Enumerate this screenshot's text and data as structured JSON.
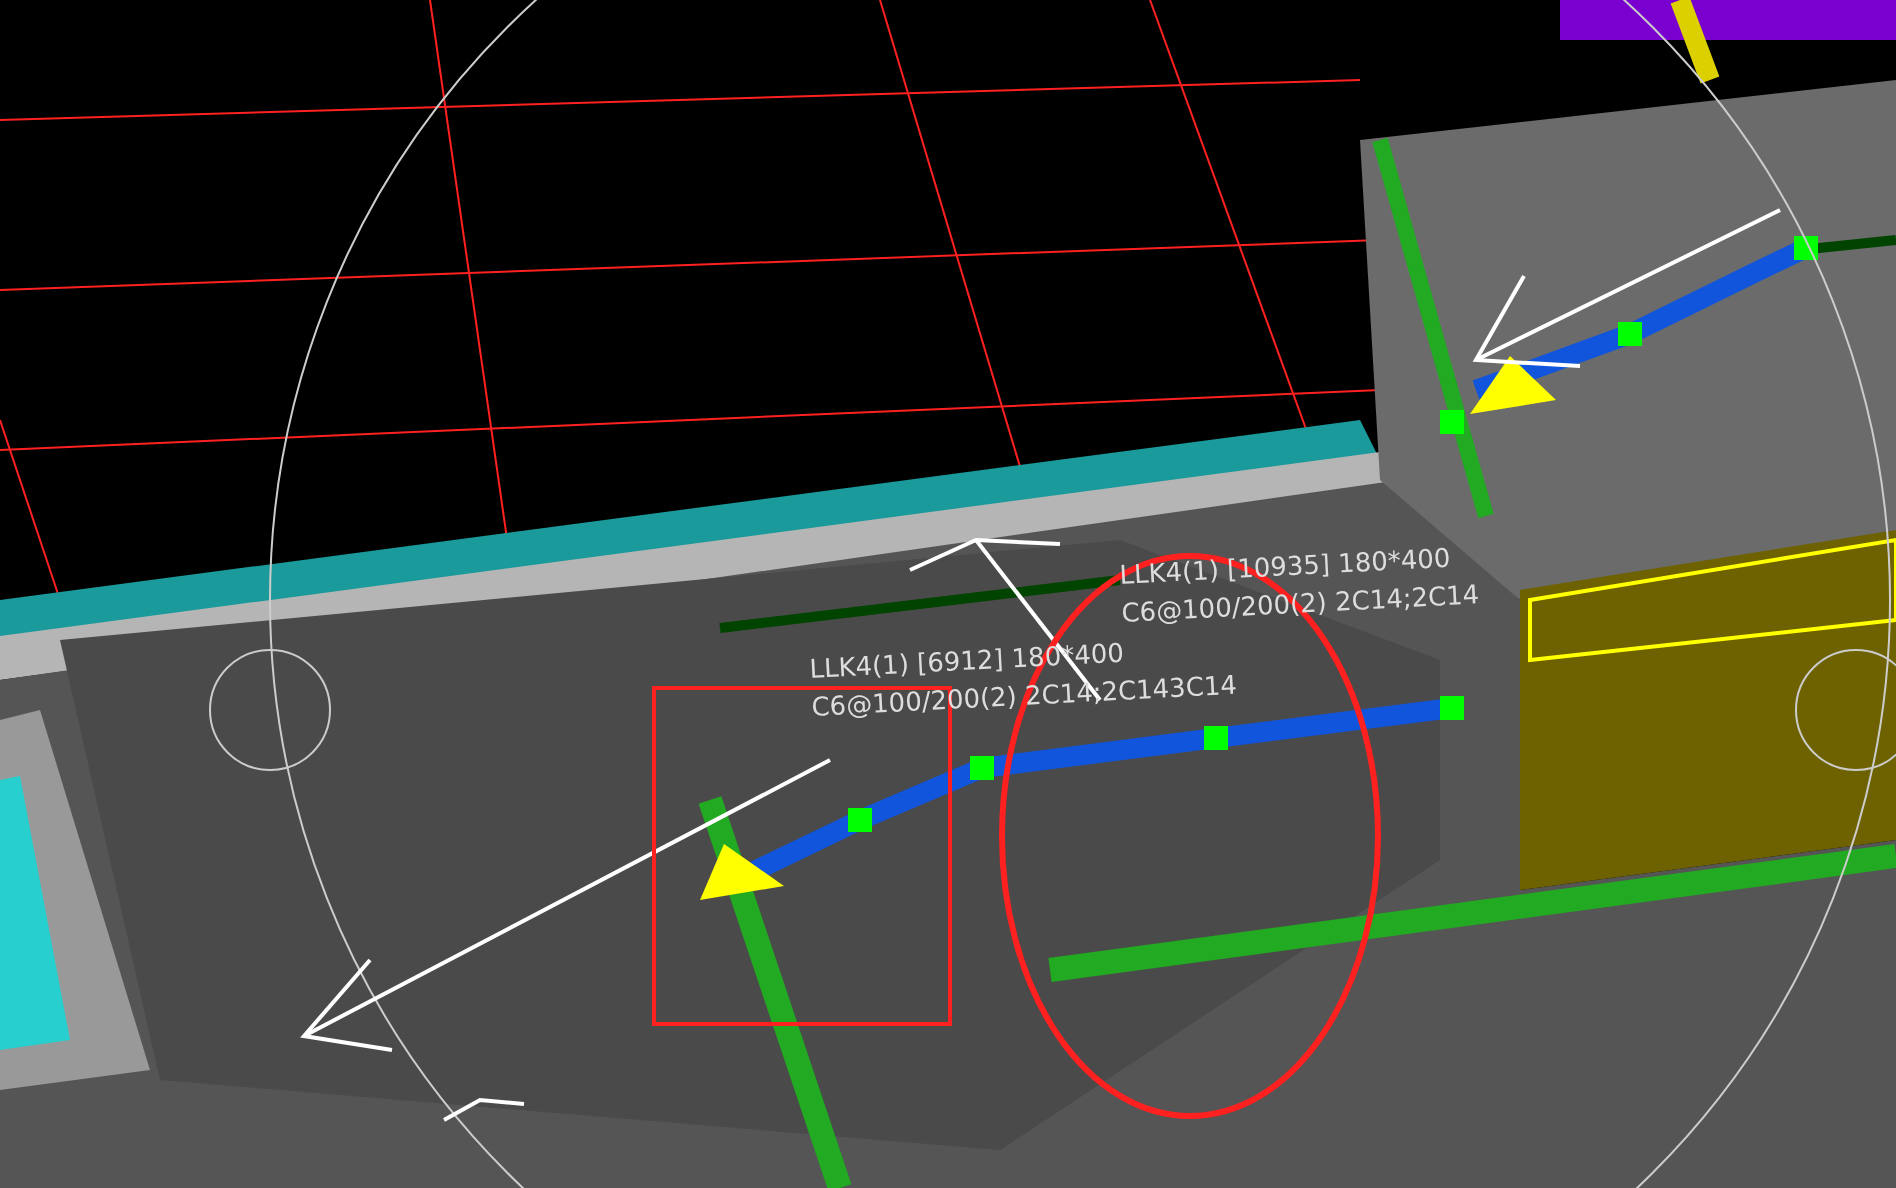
{
  "viewport": {
    "beam_labels": [
      {
        "lines": [
          "LLK4(1) [10935] 180*400",
          "C6@100/200(2) 2C14;2C14"
        ]
      },
      {
        "lines": [
          "LLK4(1) [6912] 180*400",
          "C6@100/200(2) 2C14;2C143C14"
        ]
      }
    ]
  }
}
